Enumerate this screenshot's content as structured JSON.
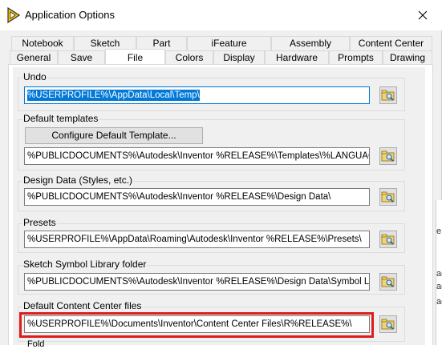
{
  "window": {
    "title": "Application Options",
    "close_icon": "close-icon",
    "app_icon": "inventor-icon"
  },
  "tabs": {
    "back_row": [
      "Notebook",
      "Sketch",
      "Part",
      "iFeature",
      "Assembly",
      "Content Center"
    ],
    "front_row": [
      "General",
      "Save",
      "File",
      "Colors",
      "Display",
      "Hardware",
      "Prompts",
      "Drawing"
    ],
    "active": "File"
  },
  "groups": {
    "undo": {
      "label": "Undo",
      "value": "%USERPROFILE%\\AppData\\Local\\Temp\\"
    },
    "default_templates": {
      "label": "Default templates",
      "button": "Configure Default Template...",
      "value": "%PUBLICDOCUMENTS%\\Autodesk\\Inventor %RELEASE%\\Templates\\%LANGUAGE%\\"
    },
    "design_data": {
      "label": "Design Data (Styles, etc.)",
      "value": "%PUBLICDOCUMENTS%\\Autodesk\\Inventor %RELEASE%\\Design Data\\"
    },
    "presets": {
      "label": "Presets",
      "value": "%USERPROFILE%\\AppData\\Roaming\\Autodesk\\Inventor %RELEASE%\\Presets\\"
    },
    "sketch_symbol": {
      "label": "Sketch Symbol Library folder",
      "value": "%PUBLICDOCUMENTS%\\Autodesk\\Inventor %RELEASE%\\Design Data\\Symbol Library\\"
    },
    "content_center": {
      "label": "Default Content Center files",
      "value": "%USERPROFILE%\\Documents\\Inventor\\Content Center Files\\R%RELEASE%\\"
    }
  },
  "bottom_partial_label": "Fold",
  "background_fragments": [
    "e",
    "ac",
    "ac",
    "ac"
  ]
}
